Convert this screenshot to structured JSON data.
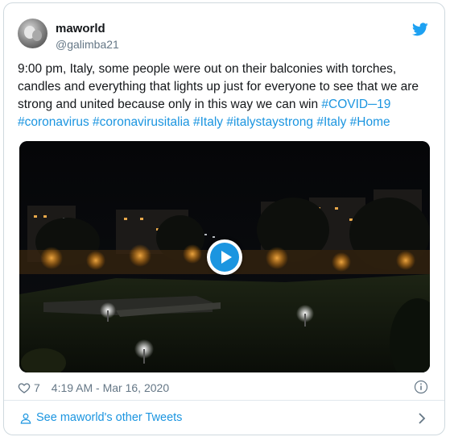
{
  "tweet": {
    "display_name": "maworld",
    "handle": "@galimba21",
    "text_plain": "9:00 pm, Italy, some people were out on their balconies with torches, candles and everything that lights up just for everyone to see that we are strong and united because only in this way we can win ",
    "text_hashtags": "#COVID─19 #coronavirus #coronavirusitalia #Italy #italystaystrong #Italy #Home",
    "like_count": "7",
    "timestamp": "4:19 AM - Mar 16, 2020"
  },
  "footer": {
    "see_more_label": "See maworld's other Tweets"
  },
  "icons": {
    "brand": "twitter-bird-icon",
    "like": "heart-icon",
    "info": "info-icon",
    "profile": "person-icon",
    "next": "chevron-right-icon",
    "media_control": "play-icon"
  },
  "colors": {
    "link": "#1b95e0",
    "text": "#14171a",
    "secondary": "#657786",
    "border": "#cfd9de"
  }
}
